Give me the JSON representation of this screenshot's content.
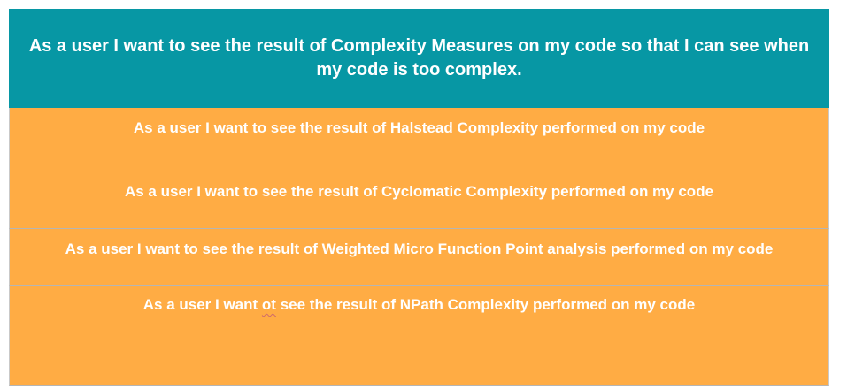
{
  "epic": {
    "text": "As a user I want to see the result of Complexity Measures on my code so that I can see when my code is too complex."
  },
  "stories": [
    {
      "text": "As a user I want to see the result of Halstead Complexity performed on my code"
    },
    {
      "text": "As a user I want to see the result of Cyclomatic Complexity performed on my code"
    },
    {
      "text": "As a user I want to see the result of Weighted Micro Function Point analysis performed on my code"
    },
    {
      "text_before": "As a user I want ",
      "text_flagged": "ot",
      "text_after": " see the result of NPath Complexity performed on my code"
    }
  ],
  "colors": {
    "epic_background": "#0797a4",
    "story_background": "#ffac44",
    "text": "#ffffff",
    "spellcheck_underline": "#d06a6a"
  }
}
